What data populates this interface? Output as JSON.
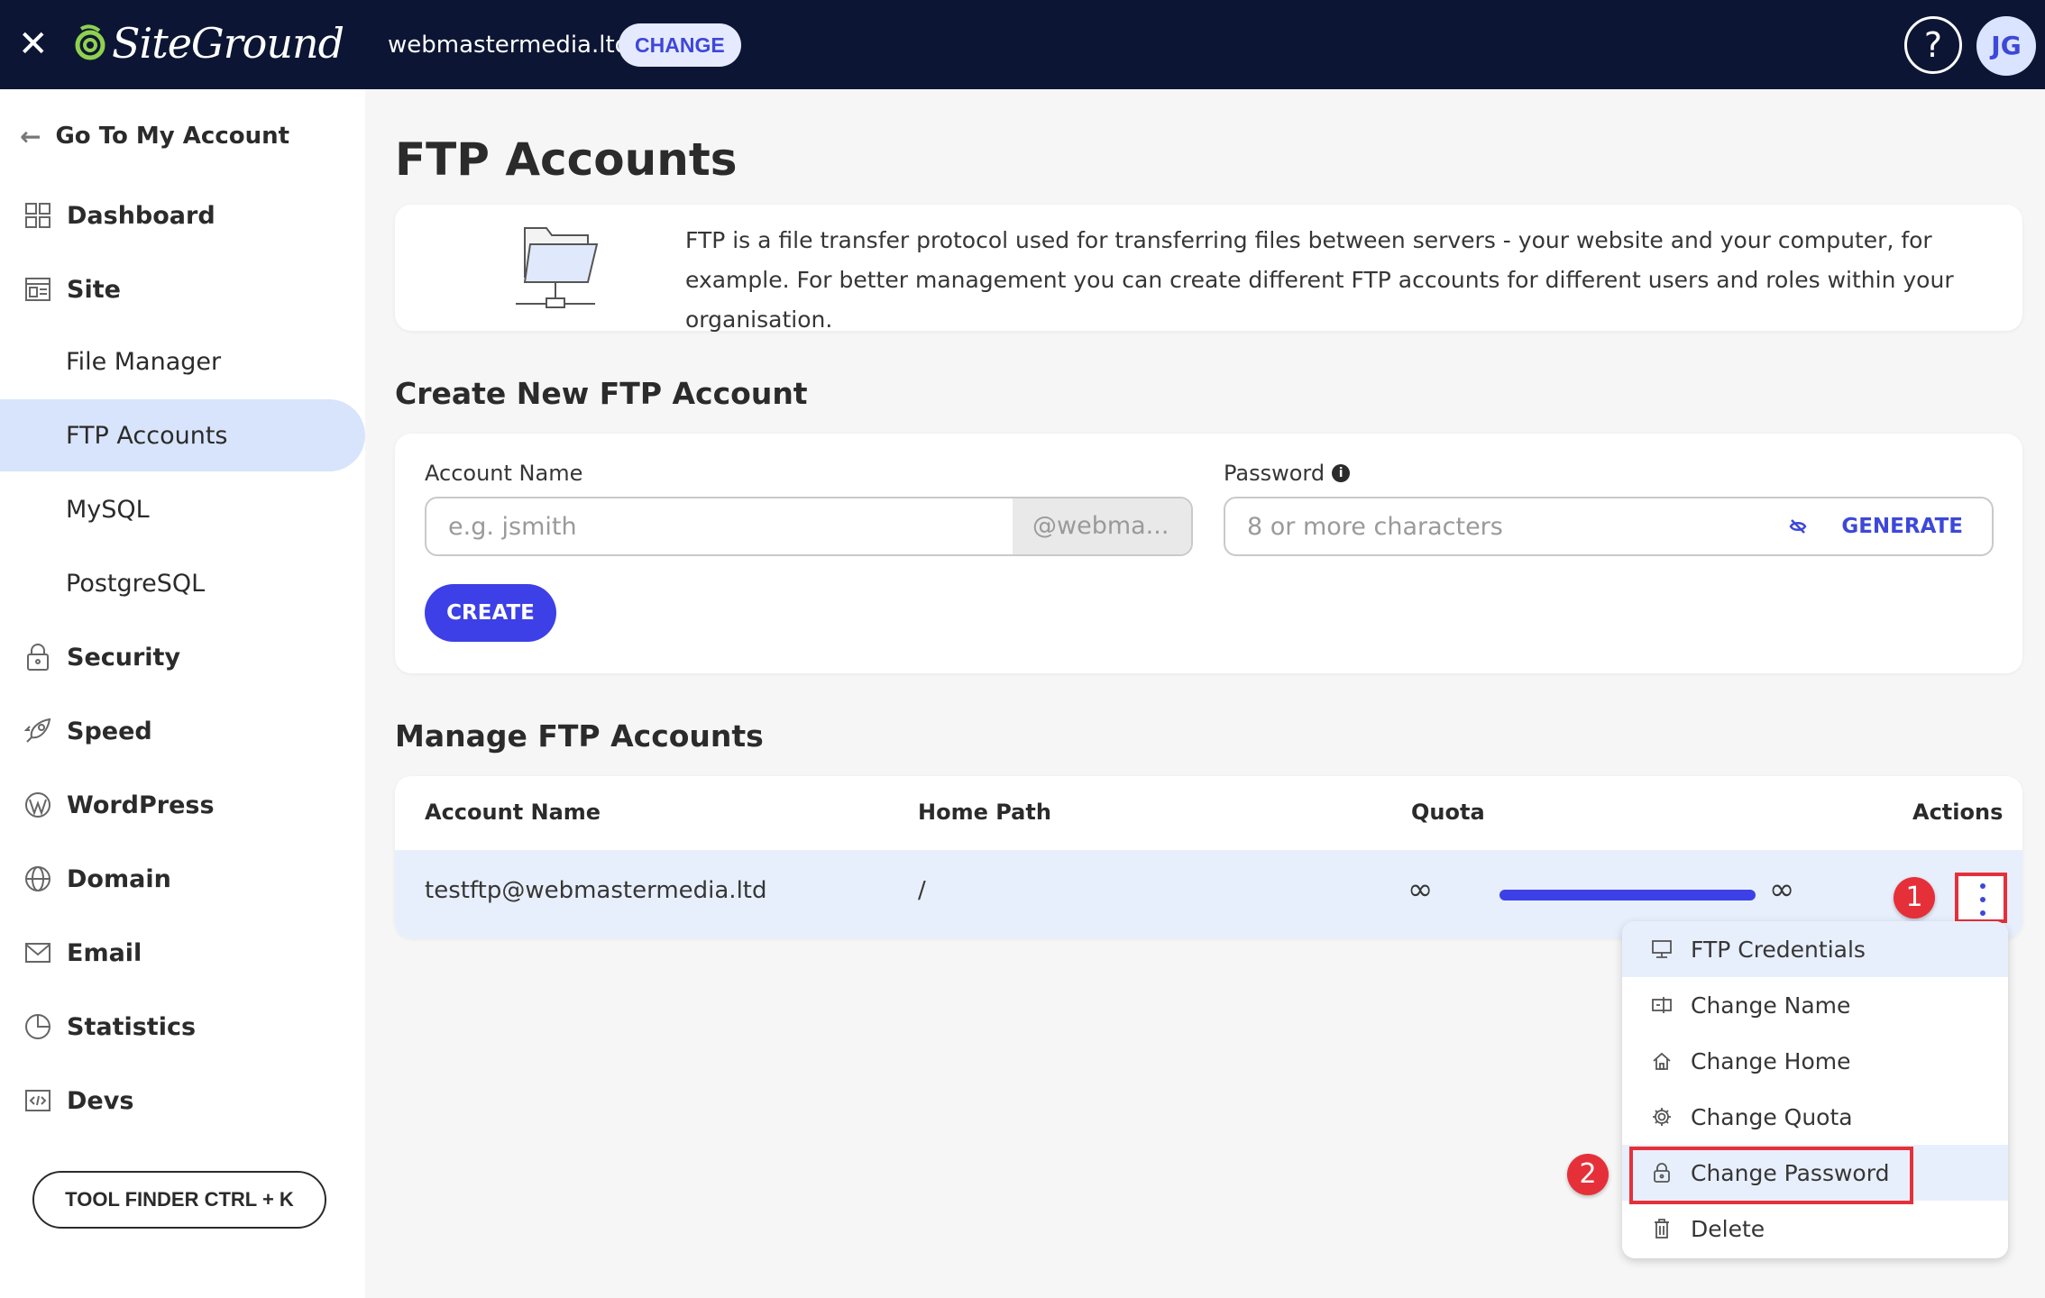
{
  "topbar": {
    "close_label": "✕",
    "logo_text": "SiteGround",
    "domain": "webmastermedia.ltd",
    "change_label": "CHANGE",
    "help_label": "?",
    "avatar_initials": "JG"
  },
  "sidebar": {
    "back_label": "Go To My Account",
    "items": [
      {
        "label": "Dashboard",
        "icon": "dashboard-icon"
      },
      {
        "label": "Site",
        "icon": "site-icon"
      },
      {
        "label": "File Manager"
      },
      {
        "label": "FTP Accounts"
      },
      {
        "label": "MySQL"
      },
      {
        "label": "PostgreSQL"
      },
      {
        "label": "Security",
        "icon": "lock-icon"
      },
      {
        "label": "Speed",
        "icon": "rocket-icon"
      },
      {
        "label": "WordPress",
        "icon": "wordpress-icon"
      },
      {
        "label": "Domain",
        "icon": "globe-icon"
      },
      {
        "label": "Email",
        "icon": "envelope-icon"
      },
      {
        "label": "Statistics",
        "icon": "pie-chart-icon"
      },
      {
        "label": "Devs",
        "icon": "code-icon"
      }
    ],
    "active_item": "FTP Accounts",
    "tool_finder_label": "TOOL FINDER CTRL + K"
  },
  "page": {
    "title": "FTP Accounts",
    "intro_text": "FTP is a file transfer protocol used for transferring files between servers - your website and your computer, for example. For better management you can create different FTP accounts for different users and roles within your organisation."
  },
  "create": {
    "title": "Create New FTP Account",
    "account_name_label": "Account Name",
    "account_name_placeholder": "e.g. jsmith",
    "account_name_value": "",
    "domain_suffix": "@webma...",
    "password_label": "Password",
    "password_placeholder": "8 or more characters",
    "password_value": "",
    "generate_label": "GENERATE",
    "create_label": "CREATE"
  },
  "manage": {
    "title": "Manage FTP Accounts",
    "columns": [
      "Account Name",
      "Home Path",
      "Quota",
      "Actions"
    ],
    "rows": [
      {
        "account": "testftp@webmastermedia.ltd",
        "home_path": "/",
        "quota_used": "∞",
        "quota_total": "∞",
        "quota_fill_percent": 100
      }
    ]
  },
  "actions_menu": {
    "items": [
      {
        "label": "FTP Credentials",
        "icon": "monitor-icon"
      },
      {
        "label": "Change Name",
        "icon": "rename-icon"
      },
      {
        "label": "Change Home",
        "icon": "home-icon"
      },
      {
        "label": "Change Quota",
        "icon": "gear-icon"
      },
      {
        "label": "Change Password",
        "icon": "lock-icon"
      },
      {
        "label": "Delete",
        "icon": "trash-icon"
      }
    ]
  },
  "annotations": {
    "step1": "1",
    "step2": "2",
    "color": "#e5303a"
  },
  "colors": {
    "topbar": "#0c1634",
    "accent": "#3d40e6",
    "active_nav": "#d8e4fb",
    "row_highlight": "#e8effc"
  }
}
